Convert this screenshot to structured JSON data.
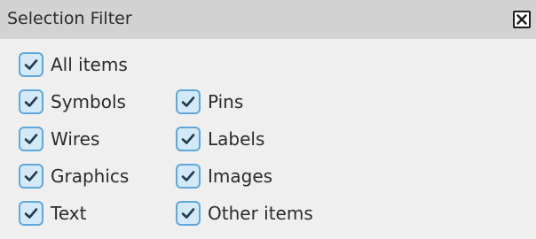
{
  "panel": {
    "title": "Selection Filter"
  },
  "filters": {
    "all_items": {
      "label": "All items",
      "checked": true
    },
    "symbols": {
      "label": "Symbols",
      "checked": true
    },
    "pins": {
      "label": "Pins",
      "checked": true
    },
    "wires": {
      "label": "Wires",
      "checked": true
    },
    "labels": {
      "label": "Labels",
      "checked": true
    },
    "graphics": {
      "label": "Graphics",
      "checked": true
    },
    "images": {
      "label": "Images",
      "checked": true
    },
    "text": {
      "label": "Text",
      "checked": true
    },
    "other_items": {
      "label": "Other items",
      "checked": true
    }
  },
  "icons": {
    "close": "close-icon",
    "check": "checkmark-icon"
  },
  "colors": {
    "background": "#efefef",
    "title_bar": "#d3d3d3",
    "checkbox_border": "#5fa7d8",
    "checkbox_fill": "#d4e9f8",
    "checkmark": "#1e3a52",
    "text": "#2b2b2b"
  }
}
